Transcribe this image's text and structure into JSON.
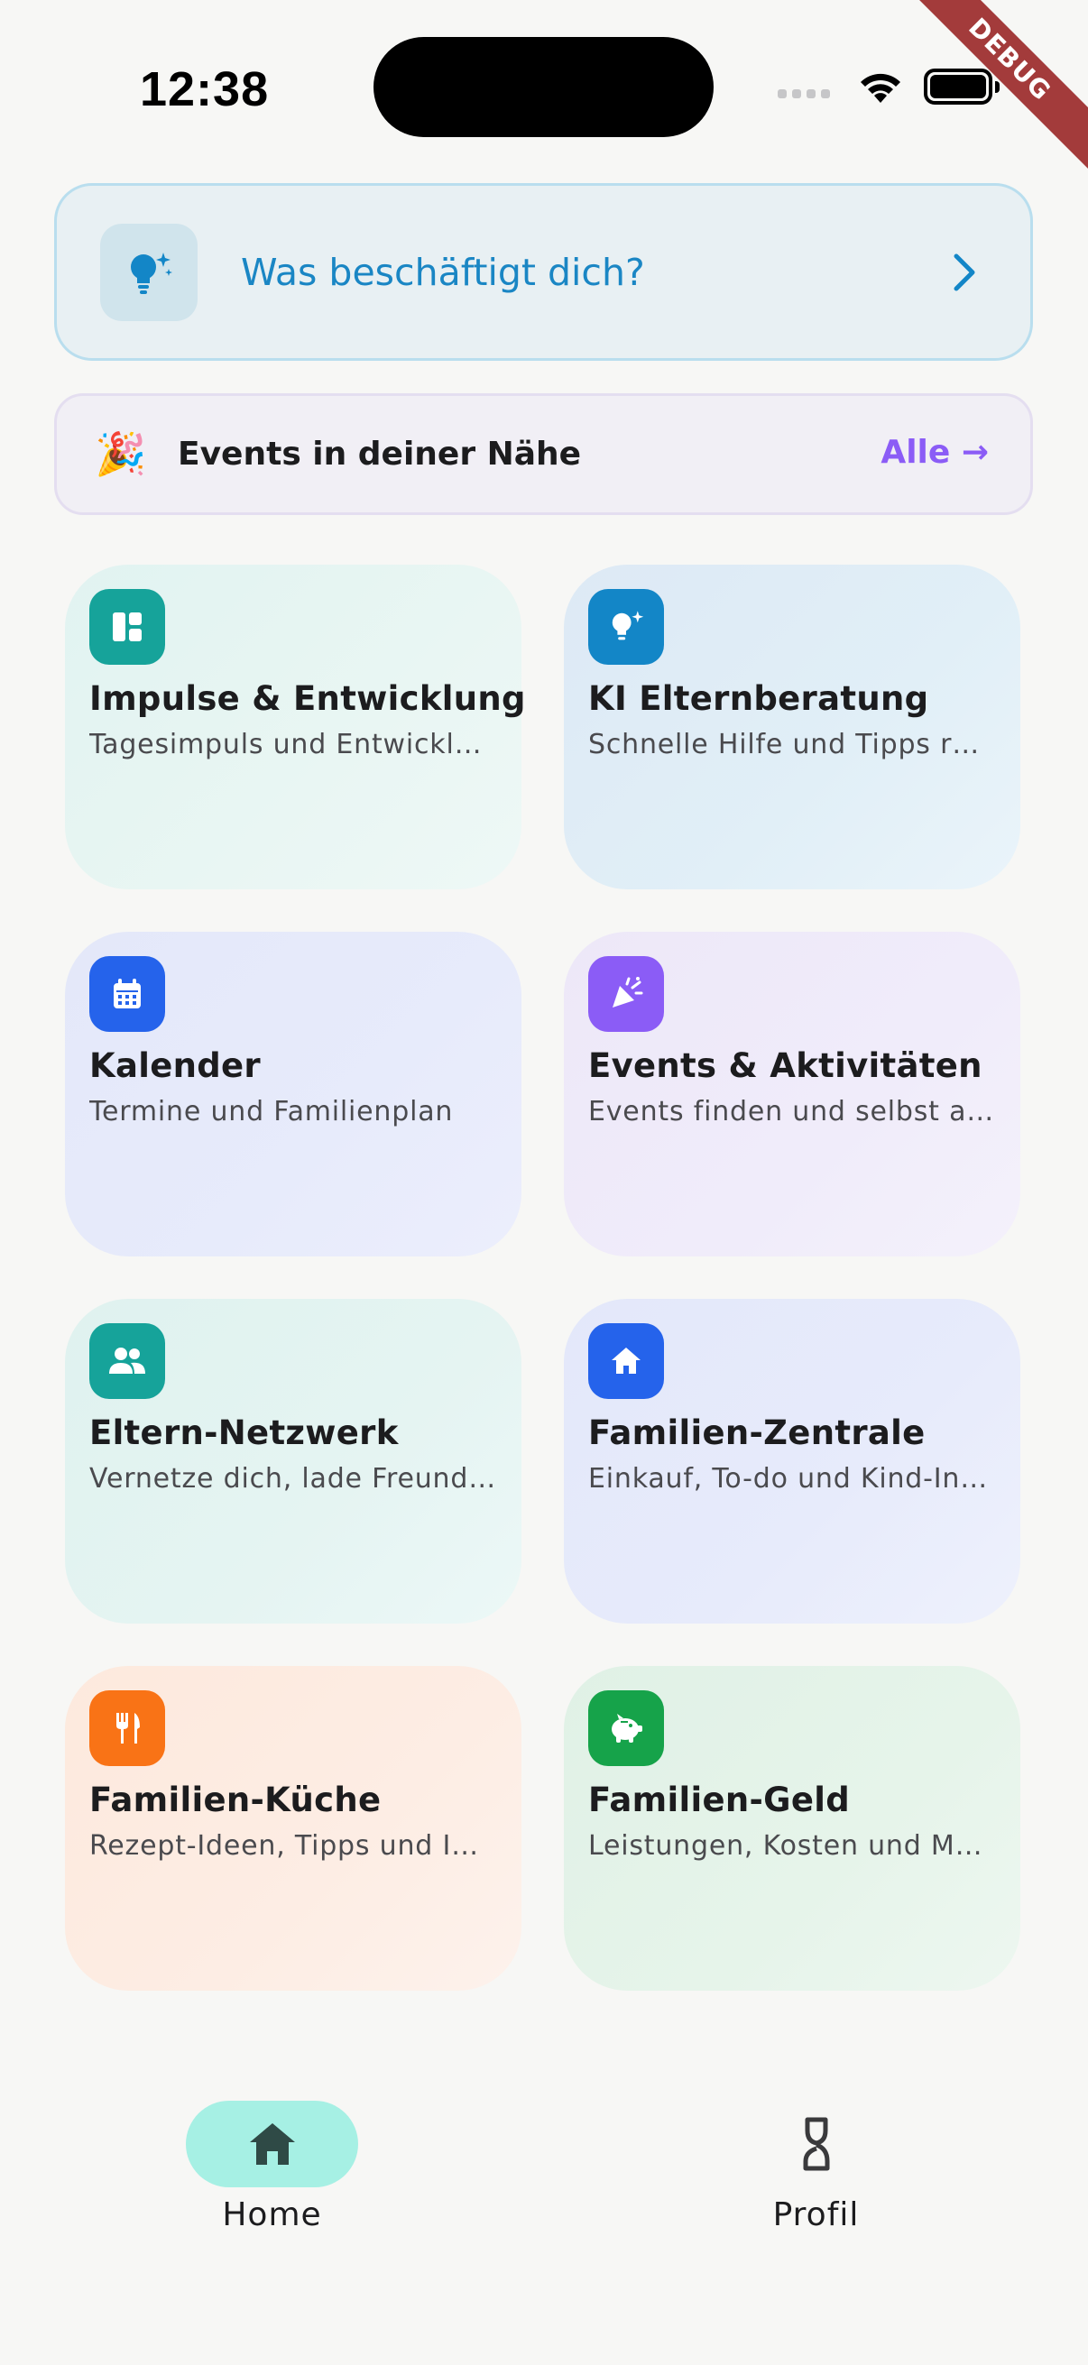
{
  "status_bar": {
    "time": "12:38"
  },
  "debug_banner": "DEBUG",
  "ask_card": {
    "label": "Was beschäftigt dich?",
    "icon": "lightbulb-sparkle-icon"
  },
  "events_bar": {
    "emoji": "🎉",
    "label": "Events in deiner Nähe",
    "all_label": "Alle →"
  },
  "tiles": [
    {
      "title": "Impulse & Entwicklung",
      "subtitle": "Tagesimpuls und Entwickl…",
      "icon": "dashboard-icon",
      "icon_color": "#16a39a"
    },
    {
      "title": "KI Elternberatung",
      "subtitle": "Schnelle Hilfe und Tipps r…",
      "icon": "lightbulb-sparkle-icon",
      "icon_color": "#1386c7"
    },
    {
      "title": "Kalender",
      "subtitle": "Termine und Familienplan",
      "icon": "calendar-icon",
      "icon_color": "#2563eb"
    },
    {
      "title": "Events & Aktivitäten",
      "subtitle": "Events finden und selbst a…",
      "icon": "party-icon",
      "icon_color": "#8b5cf6"
    },
    {
      "title": "Eltern-Netzwerk",
      "subtitle": "Vernetze dich, lade Freund…",
      "icon": "people-icon",
      "icon_color": "#16a39a"
    },
    {
      "title": "Familien-Zentrale",
      "subtitle": "Einkauf, To-do und Kind-In…",
      "icon": "home-icon",
      "icon_color": "#2563eb"
    },
    {
      "title": "Familien-Küche",
      "subtitle": "Rezept-Ideen, Tipps und I…",
      "icon": "fork-knife-icon",
      "icon_color": "#f97316"
    },
    {
      "title": "Familien-Geld",
      "subtitle": "Leistungen, Kosten und M…",
      "icon": "piggy-bank-icon",
      "icon_color": "#16a34a"
    }
  ],
  "bottom_nav": [
    {
      "label": "Home",
      "icon": "home-icon",
      "active": true
    },
    {
      "label": "Profil",
      "icon": "profile-icon",
      "active": false
    }
  ]
}
